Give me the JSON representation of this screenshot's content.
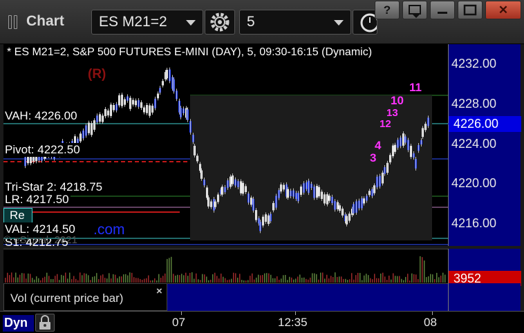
{
  "window": {
    "title": "Chart",
    "symbol": "ES M21=2",
    "interval": "5",
    "controls": [
      "?",
      "▾",
      "–",
      "☐",
      "✕"
    ]
  },
  "chart": {
    "title": "* ES M21=2, S&P 500 FUTURES E-MINI (DAY), 5, 09:30-16:15 (Dynamic)",
    "marker_r": "(R)",
    "copyright": "© eSignal, 2021",
    "watermark_com": ".com",
    "levels": {
      "vah": "VAH: 4226.00",
      "pivot": "Pivot: 4222.50",
      "r_bar": "Tri-Star 2: 4218.75",
      "lr": "LR: 4217.50",
      "val": "VAL: 4214.50",
      "s1": "S1: 4212.75",
      "re": "Re"
    },
    "count_labels": [
      "4",
      "10",
      "11",
      "13",
      "12",
      "3"
    ],
    "price_axis": [
      "4232.00",
      "4228.00",
      "4224.00",
      "4220.00",
      "4216.00"
    ],
    "current_price": "4226.00",
    "colors": {
      "up_bar": "#ffffff",
      "down_bar": "#1e3cff",
      "count_magenta": "#ff33ff",
      "count_green": "#228b22",
      "level_line_cyan": "#40d0d0",
      "pivot_line_red": "#ff2020",
      "axis_bg": "#000080",
      "volume_badge": "#cc0000"
    }
  },
  "volume": {
    "current": "3952",
    "study_label": "Vol (current price bar)",
    "close_glyph": "×"
  },
  "time_axis": {
    "mode_label": "Dyn",
    "lock_icon": "lock-icon",
    "labels": [
      "07",
      "12:35",
      "08"
    ]
  }
}
